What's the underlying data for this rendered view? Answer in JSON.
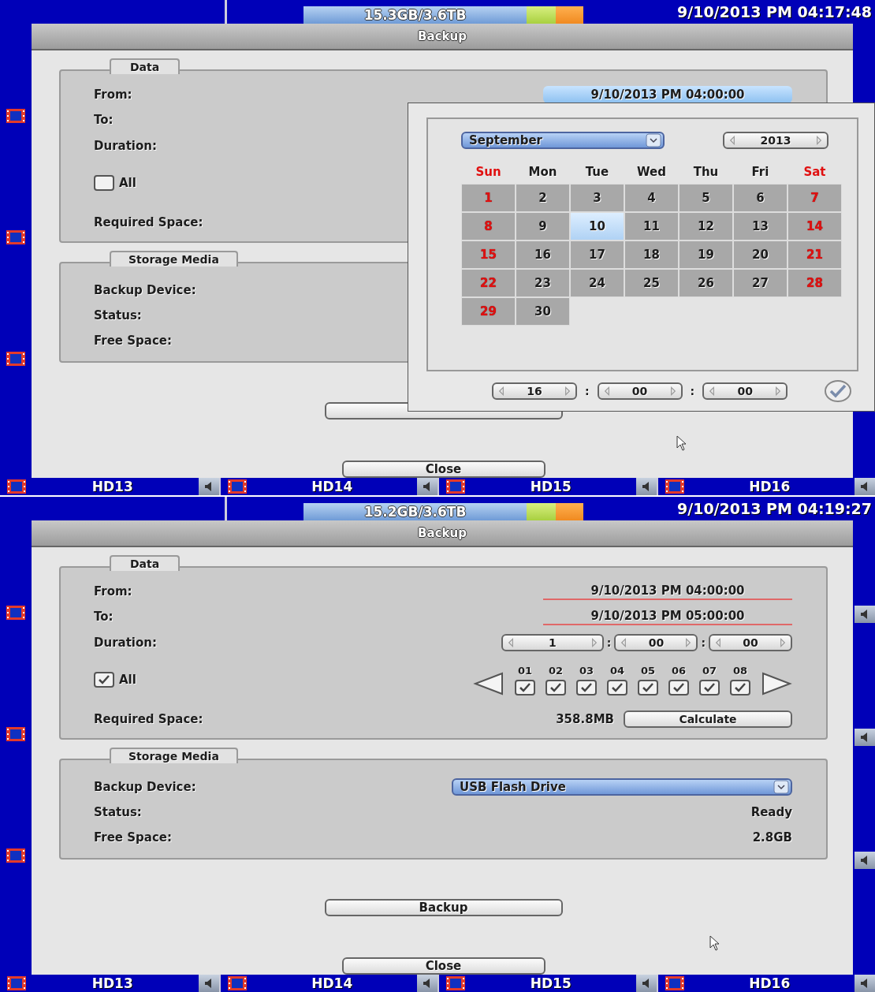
{
  "screens": [
    {
      "top_bar": {
        "storage": "15.3GB/3.6TB",
        "datetime": "9/10/2013 PM 04:17:48"
      },
      "dialog": {
        "title": "Backup",
        "data": {
          "title": "Data",
          "from": {
            "label": "From:",
            "value": "9/10/2013 PM 04:00:00",
            "selected": true
          },
          "to": {
            "label": "To:"
          },
          "duration": {
            "label": "Duration:"
          },
          "all": {
            "label": "All",
            "checked": false
          },
          "required": {
            "label": "Required Space:"
          }
        },
        "storage": {
          "title": "Storage Media",
          "device": {
            "label": "Backup Device:"
          },
          "status": {
            "label": "Status:"
          },
          "free": {
            "label": "Free Space:"
          }
        },
        "buttons": [
          {
            "kind": "backup"
          },
          {
            "kind": "close",
            "label": "Close"
          }
        ]
      },
      "calendar": {
        "month": "September",
        "year": "2013",
        "weekdays": [
          "Sun",
          "Mon",
          "Tue",
          "Wed",
          "Thu",
          "Fri",
          "Sat"
        ],
        "weeks": [
          [
            {
              "day": "1",
              "selected": false
            },
            {
              "day": "2",
              "selected": false
            },
            {
              "day": "3",
              "selected": false
            },
            {
              "day": "4",
              "selected": false
            },
            {
              "day": "5",
              "selected": false
            },
            {
              "day": "6",
              "selected": false
            },
            {
              "day": "7",
              "selected": false
            }
          ],
          [
            {
              "day": "8",
              "selected": false
            },
            {
              "day": "9",
              "selected": false
            },
            {
              "day": "10",
              "selected": true
            },
            {
              "day": "11",
              "selected": false
            },
            {
              "day": "12",
              "selected": false
            },
            {
              "day": "13",
              "selected": false
            },
            {
              "day": "14",
              "selected": false
            }
          ],
          [
            {
              "day": "15",
              "selected": false
            },
            {
              "day": "16",
              "selected": false
            },
            {
              "day": "17",
              "selected": false
            },
            {
              "day": "18",
              "selected": false
            },
            {
              "day": "19",
              "selected": false
            },
            {
              "day": "20",
              "selected": false
            },
            {
              "day": "21",
              "selected": false
            }
          ],
          [
            {
              "day": "22",
              "selected": false
            },
            {
              "day": "23",
              "selected": false
            },
            {
              "day": "24",
              "selected": false
            },
            {
              "day": "25",
              "selected": false
            },
            {
              "day": "26",
              "selected": false
            },
            {
              "day": "27",
              "selected": false
            },
            {
              "day": "28",
              "selected": false
            }
          ],
          [
            {
              "day": "29",
              "selected": false
            },
            {
              "day": "30",
              "selected": false
            }
          ]
        ],
        "time": {
          "spinners": [
            "16",
            "00",
            "00"
          ],
          "separator": ":"
        }
      },
      "channels": [
        "HD13",
        "HD14",
        "HD15",
        "HD16"
      ]
    },
    {
      "top_bar": {
        "storage": "15.2GB/3.6TB",
        "datetime": "9/10/2013 PM 04:19:27"
      },
      "dialog": {
        "title": "Backup",
        "data": {
          "title": "Data",
          "from": {
            "label": "From:",
            "value": "9/10/2013 PM 04:00:00",
            "selected": false
          },
          "to": {
            "label": "To:",
            "value": "9/10/2013 PM 05:00:00",
            "selected": false
          },
          "duration": {
            "label": "Duration:",
            "spinners": [
              "1",
              "00",
              "00"
            ],
            "separator": ":"
          },
          "all": {
            "label": "All",
            "checked": true,
            "items": [
              {
                "label": "01",
                "checked": true
              },
              {
                "label": "02",
                "checked": true
              },
              {
                "label": "03",
                "checked": true
              },
              {
                "label": "04",
                "checked": true
              },
              {
                "label": "05",
                "checked": true
              },
              {
                "label": "06",
                "checked": true
              },
              {
                "label": "07",
                "checked": true
              },
              {
                "label": "08",
                "checked": true
              }
            ]
          },
          "required": {
            "label": "Required Space:",
            "value": "358.8MB",
            "button": "Calculate"
          }
        },
        "storage": {
          "title": "Storage Media",
          "device": {
            "label": "Backup Device:",
            "value": "USB Flash Drive"
          },
          "status": {
            "label": "Status:",
            "value": "Ready"
          },
          "free": {
            "label": "Free Space:",
            "value": "2.8GB"
          }
        },
        "buttons": [
          {
            "kind": "backup",
            "label": "Backup"
          },
          {
            "kind": "close",
            "label": "Close"
          }
        ]
      },
      "channels": [
        "HD13",
        "HD14",
        "HD15",
        "HD16"
      ]
    }
  ]
}
